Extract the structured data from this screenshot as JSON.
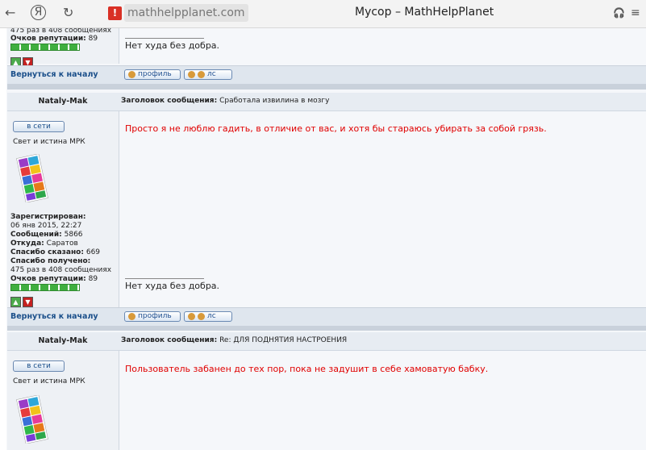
{
  "browser": {
    "url": "mathhelpplanet.com",
    "title": "Мусор – MathHelpPlanet",
    "back_icon": "←",
    "yandex_icon": "Я",
    "reload_icon": "↻",
    "headphones_icon": "🎧",
    "menu_icon": "≡"
  },
  "post0": {
    "thanks_partial": "475 раз в 408 сообщениях",
    "rep_label": "Очков репутации:",
    "rep_value": "89",
    "signature": "Нет худа без добра.",
    "back_to_top": "Вернуться к началу",
    "profile_btn": "профиль",
    "pm_btn": "лс"
  },
  "post1": {
    "author": "Nataly-Mak",
    "subject_label": "Заголовок сообщения:",
    "subject": "Сработала извилина в мозгу",
    "online": "в сети",
    "rank": "Свет и истина МРК",
    "message": "Просто я не люблю гадить, в отличие от вас, и хотя бы стараюсь убирать за собой грязь.",
    "registered_label": "Зарегистрирован:",
    "registered": "06 янв 2015, 22:27",
    "posts_label": "Сообщений:",
    "posts": "5866",
    "from_label": "Откуда:",
    "from": "Саратов",
    "thanks_said_label": "Спасибо сказано:",
    "thanks_said": "669",
    "thanks_received_label": "Спасибо получено:",
    "thanks_received": "475 раз в 408 сообщениях",
    "rep_label": "Очков репутации:",
    "rep_value": "89",
    "signature": "Нет худа без добра.",
    "back_to_top": "Вернуться к началу",
    "profile_btn": "профиль",
    "pm_btn": "лс"
  },
  "post2": {
    "author": "Nataly-Mak",
    "subject_label": "Заголовок сообщения:",
    "subject": "Re: ДЛЯ ПОДНЯТИЯ НАСТРОЕНИЯ",
    "online": "в сети",
    "rank": "Свет и истина МРК",
    "message": "Пользователь забанен до тех пор, пока не задушит в себе хамоватую бабку."
  }
}
